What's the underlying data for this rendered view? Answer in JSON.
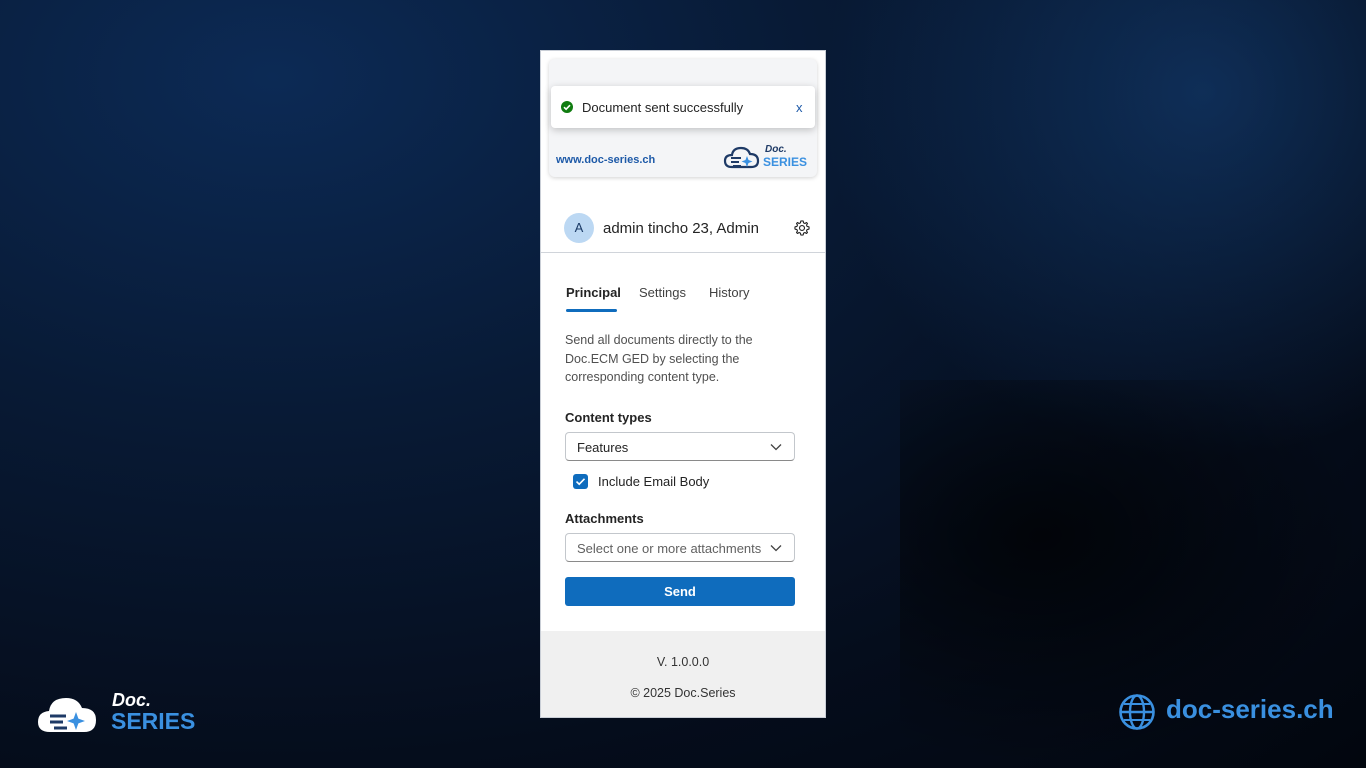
{
  "toast": {
    "message": "Document sent successfully",
    "close_label": "x"
  },
  "banner": {
    "url": "www.doc-series.ch",
    "logo_doc": "Doc.",
    "logo_series": "SERIES"
  },
  "user": {
    "avatar_initial": "A",
    "name": "admin tincho 23, Admin"
  },
  "tabs": [
    {
      "label": "Principal",
      "active": true
    },
    {
      "label": "Settings",
      "active": false
    },
    {
      "label": "History",
      "active": false
    }
  ],
  "main": {
    "description": "Send all documents directly to the Doc.ECM GED by selecting the corresponding content type.",
    "content_types_label": "Content types",
    "content_types_value": "Features",
    "include_email_body_label": "Include Email Body",
    "include_email_body_checked": true,
    "attachments_label": "Attachments",
    "attachments_placeholder": "Select one or more attachments",
    "send_label": "Send"
  },
  "footer": {
    "version": "V. 1.0.0.0",
    "copyright": "© 2025 Doc.Series"
  },
  "brand_left": {
    "doc": "Doc.",
    "series": "SERIES"
  },
  "brand_right": {
    "text": "doc-series.ch"
  },
  "colors": {
    "accent": "#0f6cbd",
    "brand_blue": "#3a90e0",
    "success": "#107c10"
  }
}
